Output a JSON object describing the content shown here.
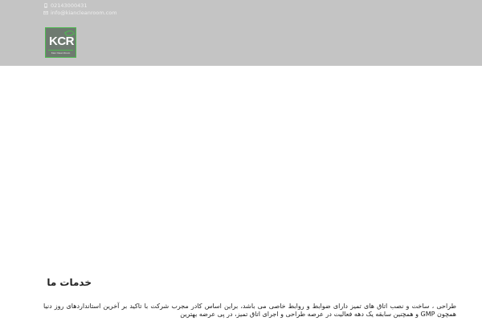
{
  "header": {
    "phone": "02143000431",
    "email": "info@kiancleanroom.com",
    "logo": {
      "text": "KCR",
      "subtitle": "Kian Clean Room"
    }
  },
  "services": {
    "title": "خدمات ما",
    "description": "طراحی ، ساخت و نصب اتاق های تمیز دارای ضوابط و روابط خاصی می باشد، براین اساس کادر مجرب شرکت با تاکید بر آخرین استانداردهای روز دنیا همچون GMP و همچنین سابقه یک دهه فعالیت در عرصه طراحی و اجرای اتاق تمیز، در پی عرضه بهترین"
  },
  "colors": {
    "header_bg": "#c4c4c4",
    "logo_bg": "#6e7a70",
    "logo_accent": "#4dbb4f",
    "text": "#222222"
  }
}
